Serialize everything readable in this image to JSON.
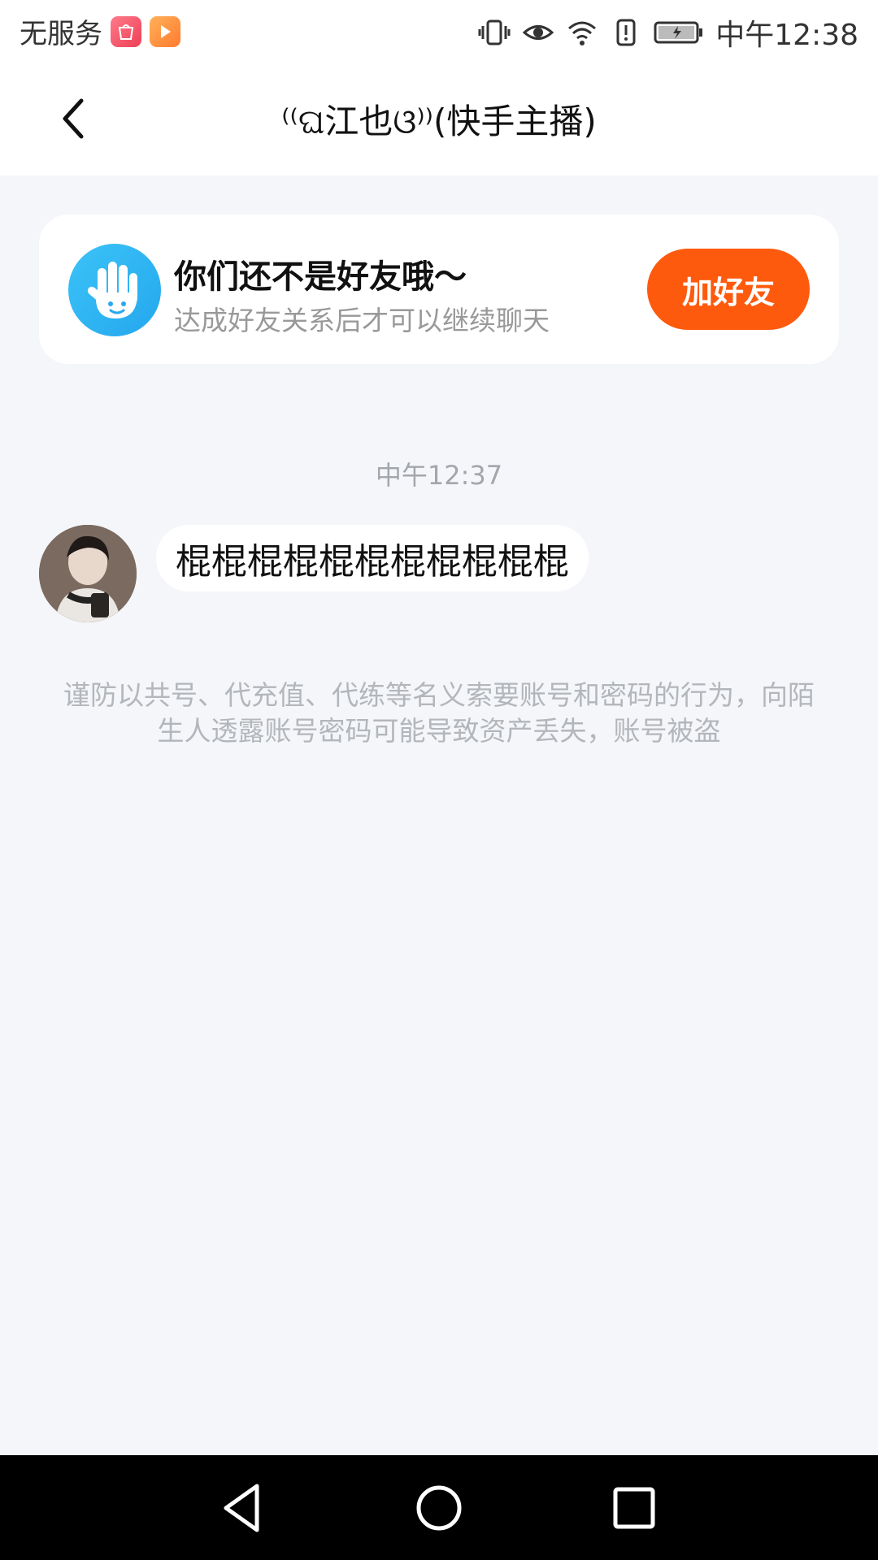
{
  "status_bar": {
    "carrier": "无服务",
    "time": "中午12:38",
    "icons": [
      "huawei-store-icon",
      "video-app-icon",
      "vibrate-icon",
      "eye-comfort-icon",
      "wifi-icon",
      "alert-icon",
      "battery-charging-icon"
    ]
  },
  "header": {
    "title": "⁽⁽ଘ江也ଓ⁾⁾(快手主播)"
  },
  "friend_card": {
    "title": "你们还不是好友哦～",
    "subtitle": "达成好友关系后才可以继续聊天",
    "button_label": "加好友",
    "button_color": "#fe5a0e"
  },
  "chat": {
    "timestamp": "中午12:37",
    "messages": [
      {
        "text": "棍棍棍棍棍棍棍棍棍棍棍"
      }
    ],
    "warning": "谨防以共号、代充值、代练等名义索要账号和密码的行为，向陌生人透露账号密码可能导致资产丢失，账号被盗"
  },
  "nav_bar": {
    "icons": [
      "back-triangle-icon",
      "home-circle-icon",
      "recents-square-icon"
    ]
  }
}
